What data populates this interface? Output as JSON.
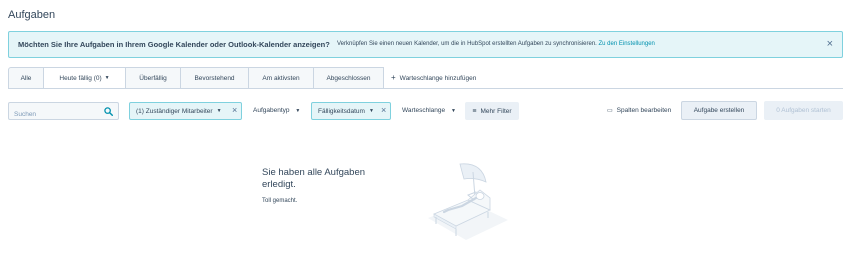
{
  "page": {
    "title": "Aufgaben"
  },
  "banner": {
    "title": "Möchten Sie Ihre Aufgaben in Ihrem Google Kalender oder Outlook-Kalender anzeigen?",
    "text": "Verknüpfen Sie einen neuen Kalender, um die in HubSpot erstellten Aufgaben zu synchronisieren.",
    "link": "Zu den Einstellungen",
    "close_icon": "×"
  },
  "tabs": [
    {
      "label": "Alle"
    },
    {
      "label": "Heute fällig (0)",
      "caret": "▼",
      "active": true
    },
    {
      "label": "Überfällig"
    },
    {
      "label": "Bevorstehend"
    },
    {
      "label": "Am aktivsten"
    },
    {
      "label": "Abgeschlossen"
    }
  ],
  "add_queue": {
    "icon": "+",
    "label": "Warteschlange hinzufügen"
  },
  "search": {
    "placeholder": "Suchen",
    "value": ""
  },
  "filters": {
    "assignee": {
      "label": "(1) Zuständiger Mitarbeiter",
      "caret": "▼",
      "clear": "×"
    },
    "task_type": {
      "label": "Aufgabentyp",
      "caret": "▼"
    },
    "due_date": {
      "label": "Fälligkeitsdatum",
      "caret": "▼",
      "clear": "×"
    },
    "queue": {
      "label": "Warteschlange",
      "caret": "▼"
    },
    "more": {
      "icon": "≡",
      "label": "Mehr Filter"
    }
  },
  "actions": {
    "edit_columns": {
      "icon": "▭",
      "label": "Spalten bearbeiten"
    },
    "create_task": "Aufgabe erstellen",
    "start_tasks": "0 Aufgaben starten"
  },
  "empty_state": {
    "title": "Sie haben alle Aufgaben erledigt.",
    "subtitle": "Toll gemacht.",
    "illustration": "relaxing-lounge-chair-illustration"
  },
  "colors": {
    "text": "#33475b",
    "link": "#0091ae",
    "banner_bg": "#e5f5f8",
    "banner_border": "#7fd1de",
    "border": "#cbd6e2",
    "button_bg": "#eaf0f6"
  }
}
